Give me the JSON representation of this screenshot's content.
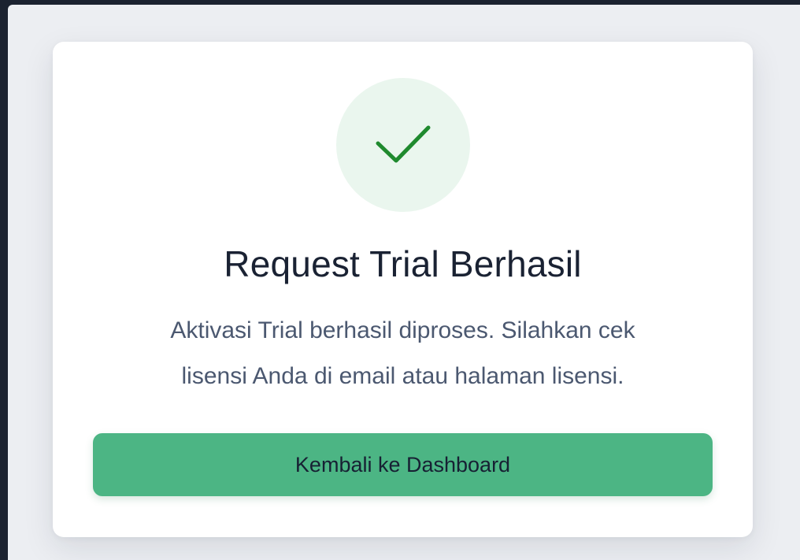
{
  "dialog": {
    "icon": "checkmark-icon",
    "title": "Request Trial Berhasil",
    "message_line1": "Aktivasi Trial berhasil diproses. Silahkan cek",
    "message_line2": "lisensi Anda di email atau halaman lisensi.",
    "button_label": "Kembali ke Dashboard"
  },
  "colors": {
    "accent_green": "#4cb584",
    "check_green": "#1f8a2e",
    "check_circle_bg": "#eaf6ee",
    "title_text": "#1a2233",
    "message_text": "#4b5870"
  }
}
